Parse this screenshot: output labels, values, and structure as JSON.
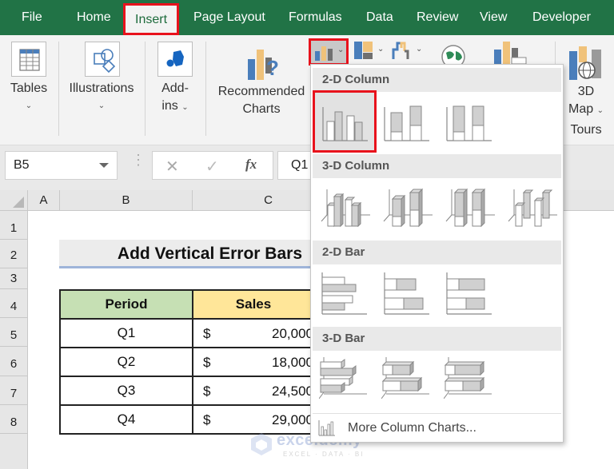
{
  "tabs": [
    {
      "label": "File"
    },
    {
      "label": "Home"
    },
    {
      "label": "Insert",
      "active": true
    },
    {
      "label": "Page Layout"
    },
    {
      "label": "Formulas"
    },
    {
      "label": "Data"
    },
    {
      "label": "Review"
    },
    {
      "label": "View"
    },
    {
      "label": "Developer"
    }
  ],
  "ribbon": {
    "tables": "Tables",
    "illustrations": "Illustrations",
    "addins_line1": "Add-",
    "addins_line2": "ins",
    "recommended_line1": "Recommended",
    "recommended_line2": "Charts",
    "map_line1": "3D",
    "map_line2": "Map",
    "tours": "Tours"
  },
  "formula_bar": {
    "name_box": "B5",
    "cancel_icon": "✕",
    "enter_icon": "✓",
    "fx_label": "fx",
    "value": "Q1"
  },
  "columns": [
    "A",
    "B",
    "C"
  ],
  "rows": [
    "1",
    "2",
    "3",
    "4",
    "5",
    "6",
    "7",
    "8"
  ],
  "sheet": {
    "title": "Add Vertical Error Bars",
    "headers": {
      "period": "Period",
      "sales": "Sales"
    },
    "data": [
      {
        "period": "Q1",
        "currency": "$",
        "sales": "20,000"
      },
      {
        "period": "Q2",
        "currency": "$",
        "sales": "18,000"
      },
      {
        "period": "Q3",
        "currency": "$",
        "sales": "24,500"
      },
      {
        "period": "Q4",
        "currency": "$",
        "sales": "29,000"
      }
    ]
  },
  "dropdown": {
    "sections": [
      {
        "label": "2-D Column",
        "items": [
          "Clustered Column",
          "Stacked Column",
          "100% Stacked Column"
        ]
      },
      {
        "label": "3-D Column",
        "items": [
          "3-D Clustered Column",
          "3-D Stacked Column",
          "3-D 100% Stacked Column",
          "3-D Column"
        ]
      },
      {
        "label": "2-D Bar",
        "items": [
          "Clustered Bar",
          "Stacked Bar",
          "100% Stacked Bar"
        ]
      },
      {
        "label": "3-D Bar",
        "items": [
          "3-D Clustered Bar",
          "3-D Stacked Bar",
          "3-D 100% Stacked Bar"
        ]
      }
    ],
    "more_label": "More Column Charts..."
  },
  "watermark": {
    "main": "exceldemy",
    "sub": "EXCEL · DATA · BI"
  },
  "colors": {
    "ribbon_green": "#217346",
    "highlight_red": "#e8121c",
    "period_header": "#c6e0b4",
    "sales_header": "#ffe699",
    "chart_blue": "#4a7ebb",
    "chart_gold": "#f0c27a",
    "chart_gray": "#707070"
  }
}
